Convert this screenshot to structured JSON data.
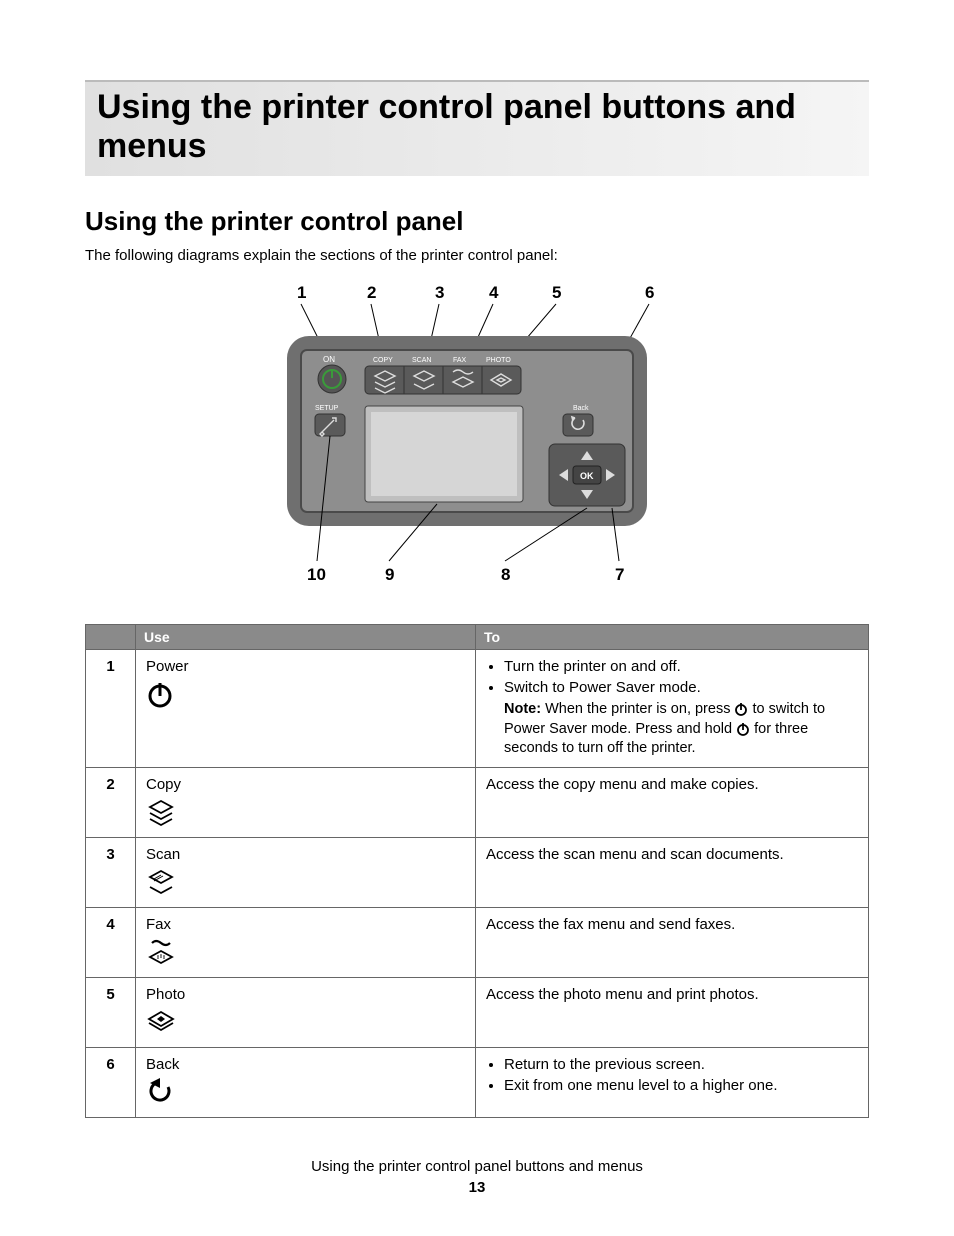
{
  "title": "Using the printer control panel buttons and menus",
  "section_title": "Using the printer control panel",
  "intro": "The following diagrams explain the sections of the printer control panel:",
  "diagram": {
    "top_labels": [
      "1",
      "2",
      "3",
      "4",
      "5",
      "6"
    ],
    "bottom_labels": [
      "10",
      "9",
      "8",
      "7"
    ],
    "buttons": {
      "on": "ON",
      "copy": "COPY",
      "scan": "SCAN",
      "fax": "FAX",
      "photo": "PHOTO",
      "setup": "SETUP",
      "back": "Back",
      "ok": "OK"
    }
  },
  "table": {
    "headers": {
      "num": "",
      "use": "Use",
      "to": "To"
    },
    "rows": [
      {
        "num": "1",
        "use": "Power",
        "icon": "power-icon",
        "to_bullets": [
          "Turn the printer on and off.",
          "Switch to Power Saver mode."
        ],
        "note_label": "Note:",
        "note_part1": " When the printer is on, press ",
        "note_part2": " to switch to Power Saver mode. Press and hold ",
        "note_part3": " for three seconds to turn off the printer."
      },
      {
        "num": "2",
        "use": "Copy",
        "icon": "copy-icon",
        "to_text": "Access the copy menu and make copies."
      },
      {
        "num": "3",
        "use": "Scan",
        "icon": "scan-icon",
        "to_text": "Access the scan menu and scan documents."
      },
      {
        "num": "4",
        "use": "Fax",
        "icon": "fax-icon",
        "to_text": "Access the fax menu and send faxes."
      },
      {
        "num": "5",
        "use": "Photo",
        "icon": "photo-icon",
        "to_text": "Access the photo menu and print photos."
      },
      {
        "num": "6",
        "use": "Back",
        "icon": "back-icon",
        "to_bullets": [
          "Return to the previous screen.",
          "Exit from one menu level to a higher one."
        ]
      }
    ]
  },
  "footer": {
    "title": "Using the printer control panel buttons and menus",
    "page": "13"
  }
}
